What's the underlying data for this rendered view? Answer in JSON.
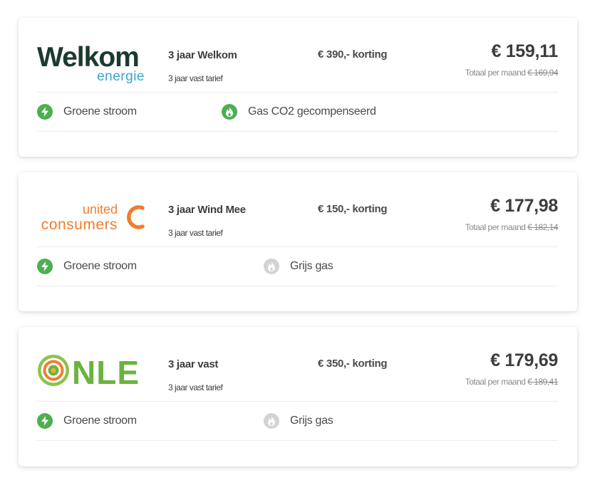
{
  "offers": [
    {
      "provider": "Welkom energie",
      "logo": {
        "line1": "Welkom",
        "line2": "energie"
      },
      "plan_name": "3 jaar Welkom",
      "plan_sub": "3 jaar vast tarief",
      "discount": "€ 390,- korting",
      "price": "€ 159,11",
      "monthly_label": "Totaal per maand",
      "monthly_old": "€ 169,94",
      "features": [
        {
          "label": "Groene stroom",
          "icon": "lightning-icon",
          "color": "#4caf50"
        },
        {
          "label": "Gas CO2 gecompenseerd",
          "icon": "flame-icon",
          "color": "#4caf50"
        }
      ]
    },
    {
      "provider": "United Consumers",
      "logo": {
        "line1": "united",
        "line2": "consumers"
      },
      "plan_name": "3 jaar Wind Mee",
      "plan_sub": "3 jaar vast tarief",
      "discount": "€ 150,- korting",
      "price": "€ 177,98",
      "monthly_label": "Totaal per maand",
      "monthly_old": "€ 182,14",
      "features": [
        {
          "label": "Groene stroom",
          "icon": "lightning-icon",
          "color": "#4caf50"
        },
        {
          "label": "Grijs gas",
          "icon": "flame-icon",
          "color": "#d3d3d3"
        }
      ]
    },
    {
      "provider": "NLE",
      "logo": {
        "line1": "NLE"
      },
      "plan_name": "3 jaar vast",
      "plan_sub": "3 jaar vast tarief",
      "discount": "€ 350,- korting",
      "price": "€ 179,69",
      "monthly_label": "Totaal per maand",
      "monthly_old": "€ 189,41",
      "features": [
        {
          "label": "Groene stroom",
          "icon": "lightning-icon",
          "color": "#4caf50"
        },
        {
          "label": "Grijs gas",
          "icon": "flame-icon",
          "color": "#d3d3d3"
        }
      ]
    }
  ],
  "colors": {
    "welkom_dark": "#1b3a2e",
    "welkom_blue": "#3aa6c8",
    "uc_orange": "#f07d2e",
    "nle_green": "#6cb33e"
  }
}
